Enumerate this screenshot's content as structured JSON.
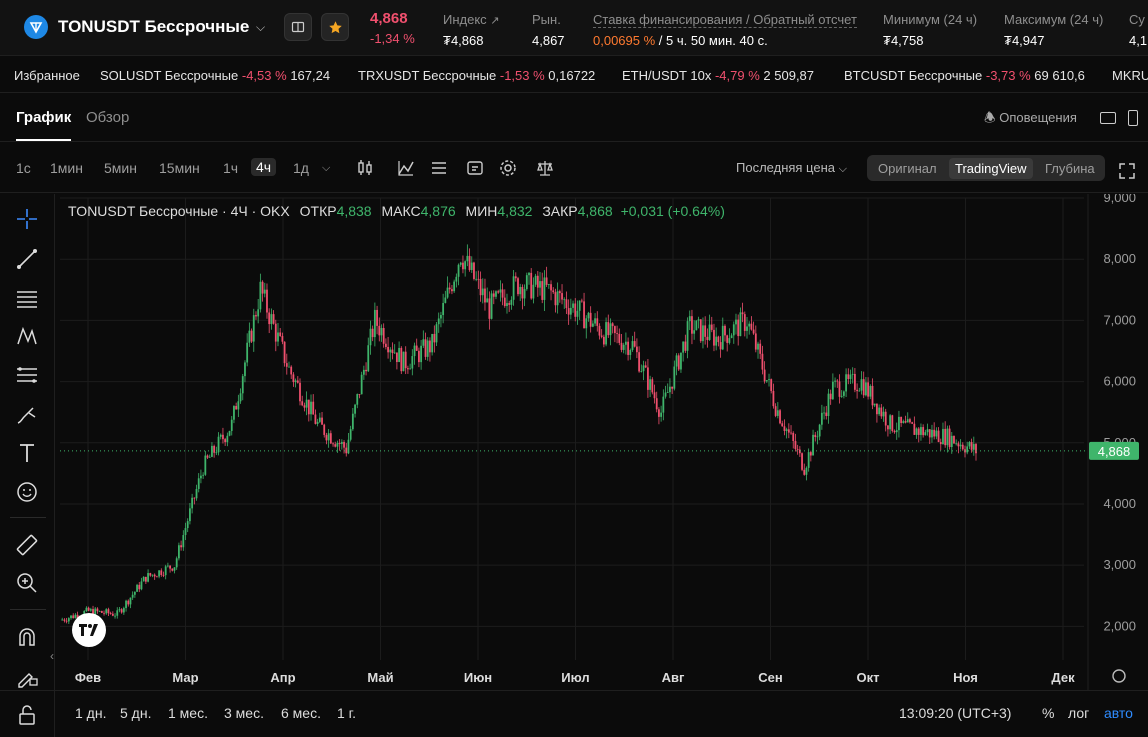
{
  "header": {
    "symbol": "TONUSDT Бессрочные",
    "last_price": "4,868",
    "change": "-1,34 %",
    "index_label": "Индекс",
    "index_value": "₮4,868",
    "mark_label": "Рын.",
    "mark_value": "4,867",
    "funding_label": "Ставка финансирования / Обратный отсчет",
    "funding_rate": "0,00695 %",
    "funding_countdown": "/ 5 ч. 50 мин. 40 с.",
    "low_label": "Минимум (24 ч)",
    "low_value": "₮4,758",
    "high_label": "Максимум (24 ч)",
    "high_value": "₮4,947",
    "extra_label": "Су",
    "extra_value": "4,1"
  },
  "ticker": {
    "favorites_label": "Избранное",
    "items": [
      {
        "name": "SOLUSDT Бессрочные",
        "change": "-4,53 %",
        "price": "167,24"
      },
      {
        "name": "TRXUSDT Бессрочные",
        "change": "-1,53 %",
        "price": "0,16722"
      },
      {
        "name": "ETH/USDT 10x",
        "change": "-4,79 %",
        "price": "2 509,87"
      },
      {
        "name": "BTCUSDT Бессрочные",
        "change": "-3,73 %",
        "price": "69 610,6"
      },
      {
        "name": "MKRU",
        "change": "",
        "price": ""
      }
    ]
  },
  "tabs": {
    "chart": "График",
    "overview": "Обзор",
    "alerts": "Оповещения"
  },
  "timeframes": [
    "1с",
    "1мин",
    "5мин",
    "15мин",
    "1ч",
    "4ч",
    "1д"
  ],
  "selected_timeframe": "4ч",
  "price_source": "Последняя цена",
  "views": [
    "Оригинал",
    "TradingView",
    "Глубина"
  ],
  "selected_view": "TradingView",
  "legend": {
    "title": "TONUSDT Бессрочные · 4Ч · OKX",
    "open_label": "ОТКР",
    "open": "4,838",
    "high_label": "МАКС",
    "high": "4,876",
    "low_label": "МИН",
    "low": "4,832",
    "close_label": "ЗАКР",
    "close": "4,868",
    "change": "+0,031 (+0.64%)"
  },
  "bottom": {
    "ranges": [
      "1 дн.",
      "5 дн.",
      "1 мес.",
      "3 мес.",
      "6 мес.",
      "1 г."
    ],
    "time": "13:09:20 (UTC+3)",
    "pct": "%",
    "log": "лог",
    "auto": "авто"
  },
  "colors": {
    "up": "#3fb56b",
    "down": "#f0506e",
    "accent_orange": "#ff7a30",
    "accent_blue": "#2f8cff"
  },
  "chart_data": {
    "type": "line",
    "title": "TONUSDT Бессрочные · 4Ч · OKX",
    "x": [
      "Фев-01",
      "Фев-15",
      "Мар-01",
      "Мар-10",
      "Мар-20",
      "Мар-28",
      "Апр-05",
      "Апр-12",
      "Апр-20",
      "Апр-28",
      "Май-01",
      "Май-10",
      "Май-20",
      "Июн-01",
      "Июн-10",
      "Июн-15",
      "Июн-25",
      "Июл-01",
      "Июл-10",
      "Июл-20",
      "Авг-01",
      "Авг-05",
      "Авг-10",
      "Авг-20",
      "Авг-25",
      "Сен-01",
      "Сен-10",
      "Сен-20",
      "Окт-01",
      "Окт-05",
      "Окт-15",
      "Окт-25",
      "Ноя-01"
    ],
    "y": [
      2.1,
      2.25,
      2.2,
      2.8,
      3.0,
      4.6,
      5.3,
      7.5,
      6.2,
      5.3,
      4.9,
      7.0,
      6.3,
      6.6,
      8.1,
      7.2,
      7.6,
      7.5,
      7.2,
      6.8,
      6.6,
      5.5,
      6.9,
      6.7,
      7.0,
      5.6,
      4.6,
      5.9,
      6.0,
      5.3,
      5.2,
      5.1,
      4.868
    ],
    "y_ticks": [
      "2,000",
      "3,000",
      "4,000",
      "5,000",
      "6,000",
      "7,000",
      "8,000",
      "9,000"
    ],
    "x_ticks": [
      "Фев",
      "Мар",
      "Апр",
      "Май",
      "Июн",
      "Июл",
      "Авг",
      "Сен",
      "Окт",
      "Ноя",
      "Дек"
    ],
    "ylim": [
      1.45,
      9.0
    ],
    "last_price_label": "4,868",
    "grid": true
  }
}
